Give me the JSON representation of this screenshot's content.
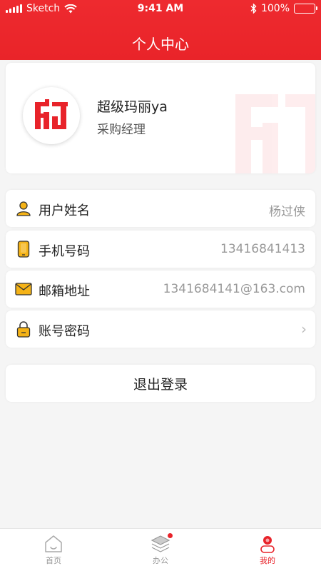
{
  "status_bar": {
    "carrier": "Sketch",
    "time": "9:41 AM",
    "battery": "100%",
    "battery_level": 1.0
  },
  "header": {
    "title": "个人中心"
  },
  "profile": {
    "name": "超级玛丽ya",
    "role": "采购经理",
    "logo_text": "HJ"
  },
  "info_rows": [
    {
      "label": "用户姓名",
      "value": "杨过侠",
      "icon": "user-icon"
    },
    {
      "label": "手机号码",
      "value": "13416841413",
      "icon": "phone-icon"
    },
    {
      "label": "邮箱地址",
      "value": "1341684141@163.com",
      "icon": "mail-icon"
    },
    {
      "label": "账号密码",
      "value": "",
      "icon": "lock-icon",
      "chevron": "›"
    }
  ],
  "logout": {
    "label": "退出登录"
  },
  "tabbar": {
    "items": [
      {
        "label": "首页",
        "icon": "home-icon",
        "active": false
      },
      {
        "label": "办公",
        "icon": "layers-icon",
        "active": false,
        "badge": true
      },
      {
        "label": "我的",
        "icon": "profile-icon",
        "active": true
      }
    ]
  },
  "colors": {
    "brand_red": "#e8232a",
    "icon_yellow": "#f5b317",
    "background": "#f5f5f5"
  }
}
